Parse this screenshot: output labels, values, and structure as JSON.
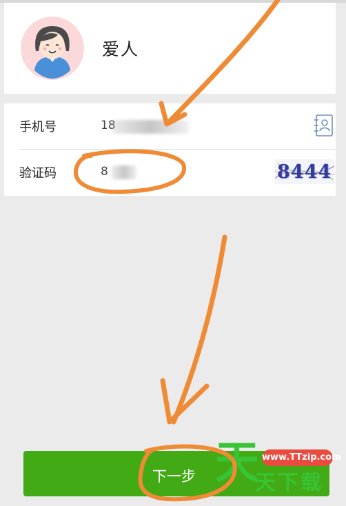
{
  "profile": {
    "name": "爱人",
    "avatar_icon": "user-avatar-icon"
  },
  "form": {
    "phone_label": "手机号",
    "phone_value": "18",
    "contacts_icon": "contacts-book-icon",
    "code_label": "验证码",
    "code_value": "8",
    "captcha_text": "8444"
  },
  "actions": {
    "next_label": "下一步"
  },
  "watermark": {
    "url": "www.TTzip.com",
    "big_char": "天",
    "small_text": "天下载"
  },
  "colors": {
    "button_green": "#41aa14",
    "annotation_orange": "#ef8a35",
    "watermark_green": "#38c434",
    "watermark_red": "#ea4b3f"
  }
}
